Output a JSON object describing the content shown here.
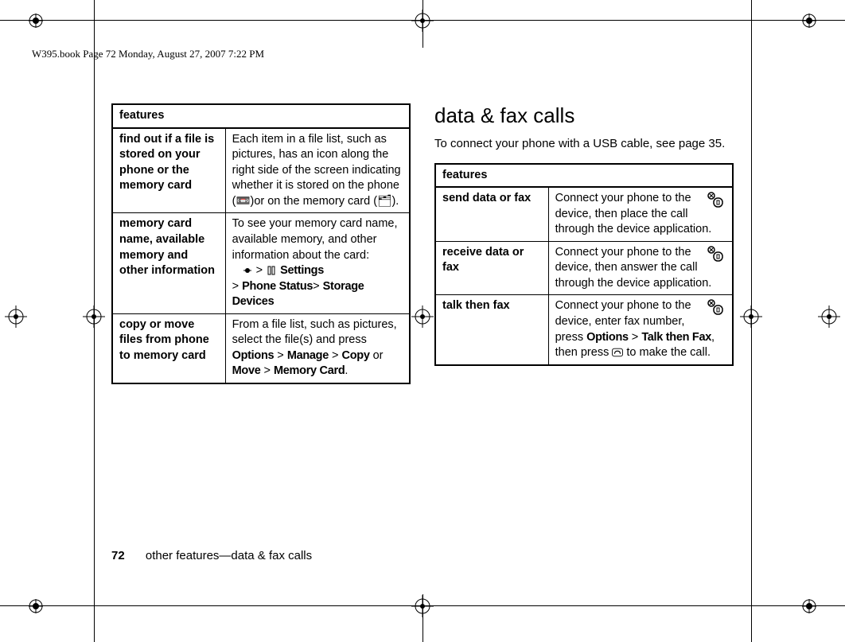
{
  "header": "W395.book  Page 72  Monday, August 27, 2007  7:22 PM",
  "leftTable": {
    "header": "features",
    "rows": [
      {
        "label": "find out if a file is stored on your phone or the memory card",
        "desc": "Each item in a file list, such as pictures, has an icon along the right side of the screen indicating whether it is stored on the phone (📼)or on the memory card (🗂)."
      },
      {
        "label": "memory card name, available memory and other information",
        "desc_pre": "To see your memory card name, available memory, and other information about the card:",
        "desc_path1": "Settings",
        "desc_path2": "Phone Status",
        "desc_path3": "Storage Devices"
      },
      {
        "label": "copy or move files from phone to memory card",
        "desc_pre": "From a file list, such as pictures, select the file(s) and press ",
        "opt": "Options",
        "manage": "Manage",
        "copy": "Copy",
        "or": " or ",
        "move": "Move",
        "mc": "Memory Card"
      }
    ]
  },
  "rightCol": {
    "heading": "data & fax calls",
    "intro": "To connect your phone with a USB cable, see page 35.",
    "table": {
      "header": "features",
      "rows": [
        {
          "label": "send data or fax",
          "desc": "Connect your phone to the device, then place the call through the device application."
        },
        {
          "label": "receive data or fax",
          "desc": "Connect your phone to the device, then answer the call through the device application."
        },
        {
          "label": "talk then fax",
          "desc_pre": "Connect your phone to the device, enter fax number, press ",
          "opt": "Options",
          "ttf": "Talk then Fax",
          "mid": ", then press ",
          "post": " to make the call."
        }
      ]
    }
  },
  "footer": {
    "page": "72",
    "section": "other features—data & fax calls"
  }
}
